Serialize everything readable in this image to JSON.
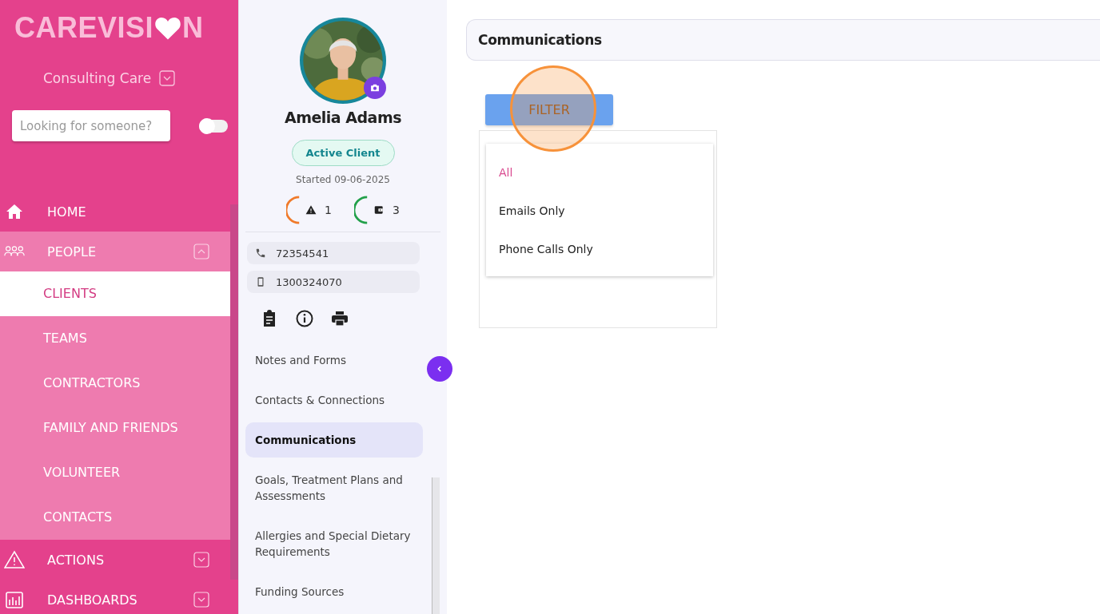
{
  "logo": {
    "before": "CAREVISI",
    "after": "N"
  },
  "organisation": {
    "name": "Consulting Care"
  },
  "search": {
    "placeholder": "Looking for someone?"
  },
  "toggle": {
    "on": false
  },
  "nav": [
    {
      "label": "HOME",
      "kind": "home"
    },
    {
      "label": "PEOPLE",
      "kind": "people",
      "expanded": true,
      "children": [
        {
          "label": "CLIENTS",
          "selected": true
        },
        {
          "label": "TEAMS",
          "selected": false
        },
        {
          "label": "CONTRACTORS",
          "selected": false
        },
        {
          "label": "FAMILY AND FRIENDS",
          "selected": false
        },
        {
          "label": "VOLUNTEER",
          "selected": false
        },
        {
          "label": "CONTACTS",
          "selected": false
        }
      ]
    },
    {
      "label": "ACTIONS",
      "kind": "actions",
      "expanded": false
    },
    {
      "label": "DASHBOARDS",
      "kind": "dashboards",
      "expanded": false
    }
  ],
  "client": {
    "name": "Amelia Adams",
    "status": "Active Client",
    "started": "Started 09-06-2025",
    "counters": [
      {
        "kind": "alerts",
        "count": "1",
        "color": "#f07a2a"
      },
      {
        "kind": "funds",
        "count": "3",
        "color": "#22a04a"
      }
    ],
    "phones": [
      {
        "kind": "phone",
        "number": "72354541"
      },
      {
        "kind": "mobile",
        "number": "1300324070"
      }
    ]
  },
  "menu": [
    {
      "label": "Notes and Forms",
      "selected": false
    },
    {
      "label": "Contacts & Connections",
      "selected": false
    },
    {
      "label": "Communications",
      "selected": true
    },
    {
      "label": "Goals, Treatment Plans and Assessments",
      "selected": false
    },
    {
      "label": "Allergies and Special Dietary Requirements",
      "selected": false
    },
    {
      "label": "Funding Sources",
      "selected": false
    }
  ],
  "page": {
    "title": "Communications",
    "filter_button": "FILTER",
    "filter_options": [
      {
        "label": "All",
        "selected": true
      },
      {
        "label": "Emails Only",
        "selected": false
      },
      {
        "label": "Phone Calls Only",
        "selected": false
      }
    ]
  }
}
